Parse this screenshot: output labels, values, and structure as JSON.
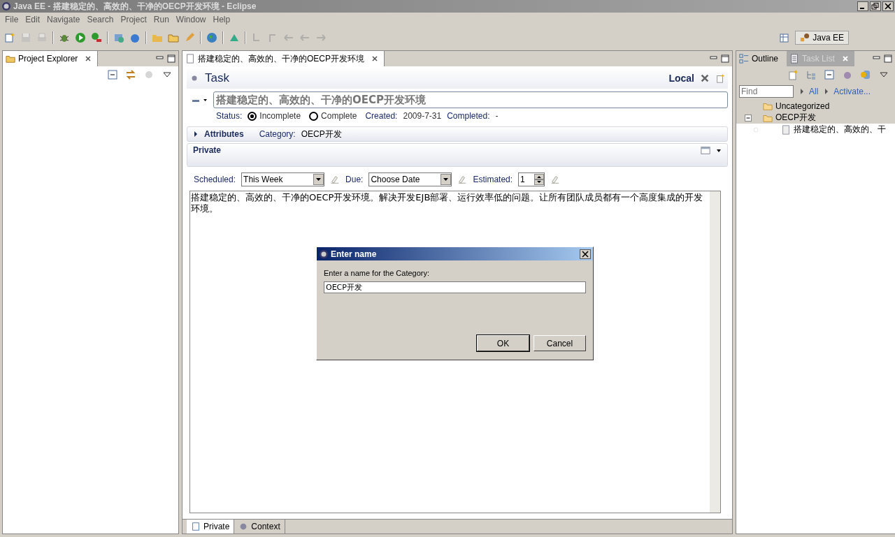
{
  "window": {
    "title": "Java EE - 搭建稳定的、高效的、干净的OECP开发环境 - Eclipse"
  },
  "menu": [
    "File",
    "Edit",
    "Navigate",
    "Search",
    "Project",
    "Run",
    "Window",
    "Help"
  ],
  "perspective": {
    "label": "Java EE"
  },
  "project_explorer": {
    "title": "Project Explorer"
  },
  "editor": {
    "tab_title": "搭建稳定的、高效的、干净的OECP开发环境",
    "header": {
      "title": "Task",
      "repository": "Local"
    },
    "summary": "搭建稳定的、高效的、干净的OECP开发环境",
    "status_label": "Status:",
    "status_options": [
      {
        "label": "Incomplete",
        "selected": true
      },
      {
        "label": "Complete",
        "selected": false
      }
    ],
    "created_label": "Created:",
    "created": "2009-7-31",
    "completed_label": "Completed:",
    "completed": "-",
    "attributes": {
      "label": "Attributes",
      "expanded": false,
      "category_label": "Category:",
      "category": "OECP开发"
    },
    "private": {
      "title": "Private",
      "scheduled_label": "Scheduled:",
      "scheduled": "This Week",
      "due_label": "Due:",
      "due": "Choose Date",
      "estimated_label": "Estimated:",
      "estimated": "1"
    },
    "notes": "搭建稳定的、高效的、干净的OECP开发环境。解决开发EJB部署、运行效率低的问题。让所有团队成员都有一个高度集成的开发环境。",
    "bottom_tabs": [
      {
        "label": "Private",
        "selected": true
      },
      {
        "label": "Context",
        "selected": false
      }
    ]
  },
  "task_list": {
    "tabs": [
      {
        "label": "Outline",
        "selected": false
      },
      {
        "label": "Task List",
        "selected": true
      }
    ],
    "find_placeholder": "Find",
    "links": [
      "All",
      "Activate..."
    ],
    "tree": [
      {
        "label": "Uncategorized"
      },
      {
        "label": "OECP开发",
        "expanded": true,
        "children": [
          {
            "label": "搭建稳定的、高效的、干"
          }
        ]
      }
    ]
  },
  "dialog": {
    "title": "Enter name",
    "prompt": "Enter a name for the Category:",
    "value": "OECP开发",
    "buttons": [
      "OK",
      "Cancel"
    ]
  }
}
